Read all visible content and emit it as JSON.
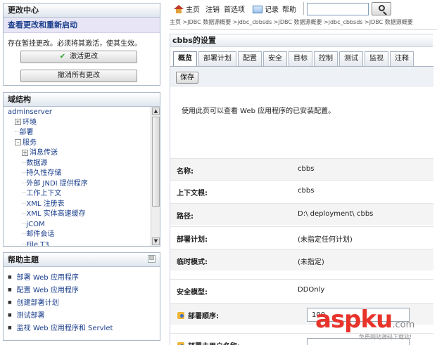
{
  "change_center": {
    "title": "更改中心",
    "link": "查看更改和重新启动",
    "message": "存在暂挂更改。必须将其激活，使其生效。",
    "activate_label": "激活更改",
    "discard_label": "撤消所有更改"
  },
  "domain_structure": {
    "title": "域结构",
    "tree": [
      {
        "label": "adminserver",
        "level": 0,
        "toggle": ""
      },
      {
        "label": "环境",
        "level": 1,
        "toggle": "+"
      },
      {
        "label": "部署",
        "level": 1,
        "toggle": ""
      },
      {
        "label": "服务",
        "level": 1,
        "toggle": "-"
      },
      {
        "label": "消息传送",
        "level": 2,
        "toggle": "+"
      },
      {
        "label": "数据源",
        "level": 2,
        "toggle": ""
      },
      {
        "label": "持久性存储",
        "level": 2,
        "toggle": ""
      },
      {
        "label": "外部 JNDI 提供程序",
        "level": 2,
        "toggle": ""
      },
      {
        "label": "工作上下文",
        "level": 2,
        "toggle": ""
      },
      {
        "label": "XML 注册表",
        "level": 2,
        "toggle": ""
      },
      {
        "label": "XML 实体高速缓存",
        "level": 2,
        "toggle": ""
      },
      {
        "label": "jCOM",
        "level": 2,
        "toggle": ""
      },
      {
        "label": "邮件会话",
        "level": 2,
        "toggle": ""
      },
      {
        "label": "File T3",
        "level": 2,
        "toggle": ""
      }
    ]
  },
  "help_topics": {
    "title": "帮助主题",
    "minimize": "⊟",
    "items": [
      "部署 Web 应用程序",
      "配置 Web 应用程序",
      "创建部署计划",
      "测试部署",
      "监视 Web 应用程序和 Servlet"
    ]
  },
  "toolbar": {
    "home": "主页",
    "logout": "注销",
    "preferences": "首选项",
    "record": "记录",
    "help": "帮助",
    "search_value": ""
  },
  "breadcrumb": "主页 >JDBC 数据源概要 >jdbc_cbbsds >JDBC 数据源概要 >jdbc_cbbsds >JDBC 数据源概要",
  "settings": {
    "title": "cbbs的设置",
    "tabs": [
      "概览",
      "部署计划",
      "配置",
      "安全",
      "目标",
      "控制",
      "测试",
      "监视",
      "注释"
    ],
    "active_tab": 0,
    "save_label": "保存",
    "description": "使用此页可以查看 Web 应用程序的已安装配置。",
    "properties": [
      {
        "label": "名称:",
        "value": "cbbs"
      },
      {
        "label": "上下文根:",
        "value": "cbbs"
      },
      {
        "label": "路径:",
        "value": "D:\\ deployment\\ cbbs"
      },
      {
        "label": "部署计划:",
        "value": "(未指定任何计划)"
      },
      {
        "label": "临时模式:",
        "value": "(未指定)"
      },
      {
        "label": "安全模型:",
        "value": "DDOnly"
      },
      {
        "label": "部署顺序:",
        "value": "100",
        "editable": true
      },
      {
        "label": "部署主用户名称:",
        "value": "",
        "editable": true
      }
    ]
  },
  "watermark": {
    "logo": "asp",
    "logo_tail": "ku",
    "logo_com": ".com",
    "subtitle": "免费网站源码下载站!"
  },
  "colors": {
    "link": "#1b3f8c",
    "accent_red": "#e8332b",
    "panel_border": "#a9b7c8"
  }
}
